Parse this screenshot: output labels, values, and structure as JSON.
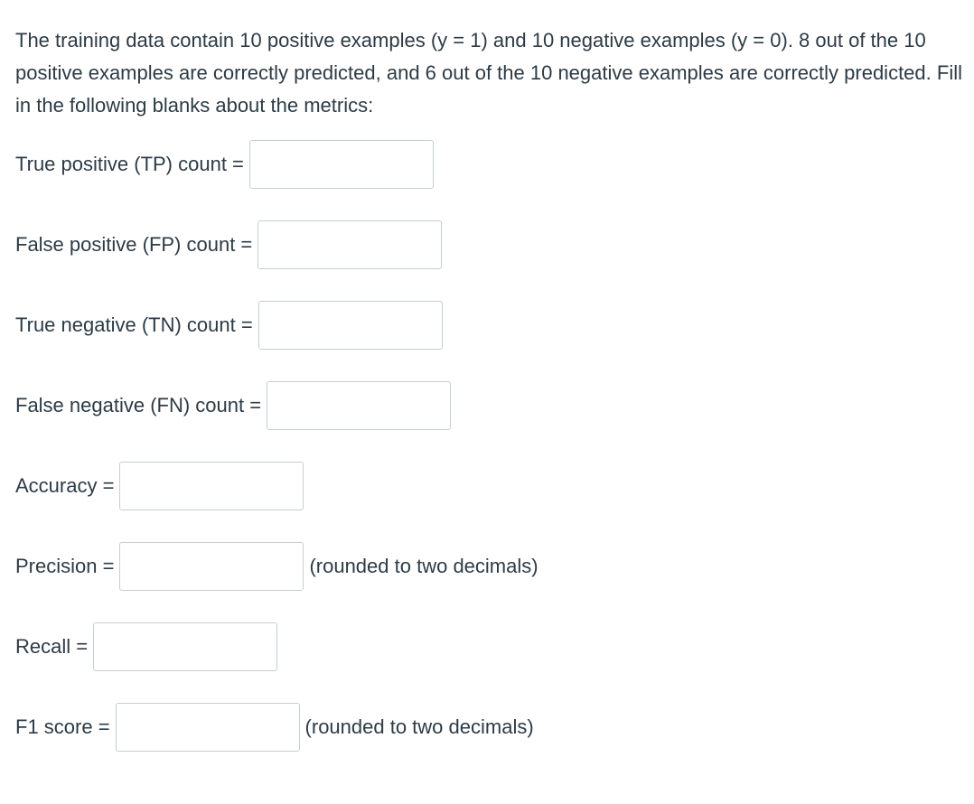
{
  "question": {
    "intro": "The training data contain 10 positive examples (y = 1) and 10 negative examples (y = 0). 8 out of the 10 positive examples are correctly predicted, and 6 out of the 10 negative examples are correctly predicted. Fill in the following blanks about the metrics:"
  },
  "fields": [
    {
      "label": "True positive (TP) count =",
      "value": "",
      "note": ""
    },
    {
      "label": "False positive (FP) count =",
      "value": "",
      "note": ""
    },
    {
      "label": "True negative (TN) count =",
      "value": "",
      "note": ""
    },
    {
      "label": "False negative (FN) count =",
      "value": "",
      "note": ""
    },
    {
      "label": "Accuracy =",
      "value": "",
      "note": ""
    },
    {
      "label": "Precision =",
      "value": "",
      "note": "(rounded to two decimals)"
    },
    {
      "label": "Recall =",
      "value": "",
      "note": ""
    },
    {
      "label": "F1 score =",
      "value": "",
      "note": "(rounded to two decimals)"
    }
  ]
}
